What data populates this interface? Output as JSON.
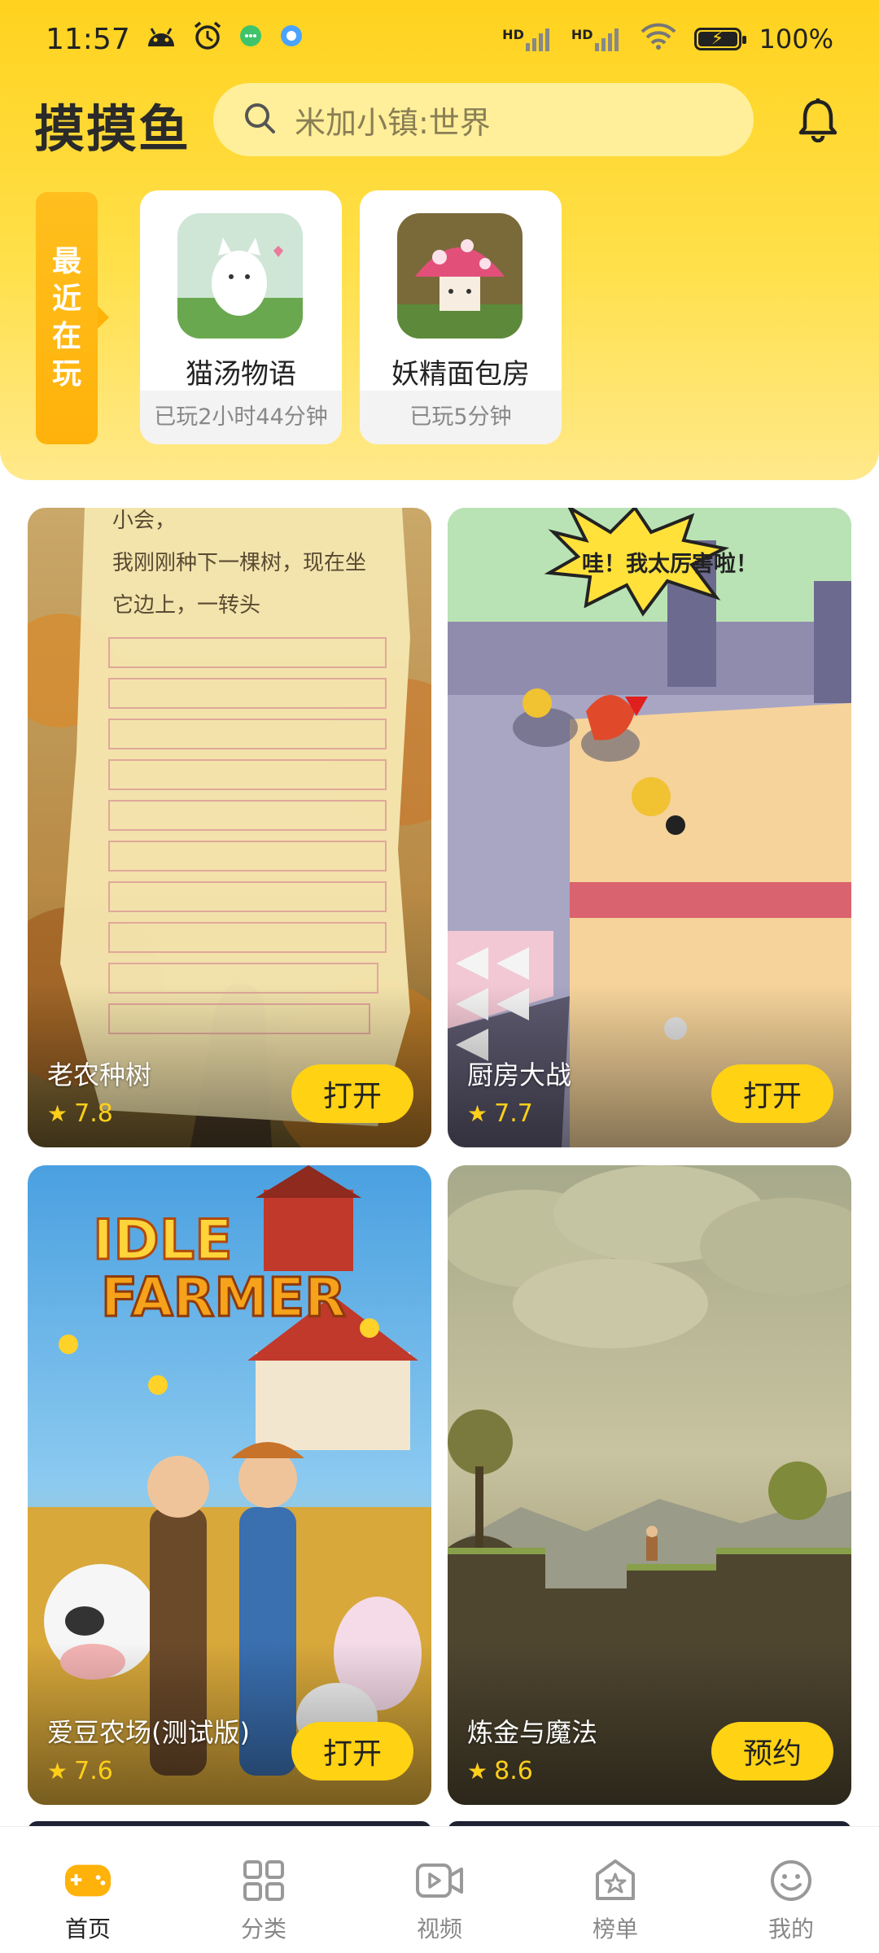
{
  "status_bar": {
    "time": "11:57",
    "net1": "HD",
    "net2": "HD",
    "battery": "100%"
  },
  "header": {
    "logo": "摸摸鱼",
    "search_placeholder": "米加小镇:世界"
  },
  "recent": {
    "label_chars": [
      "最",
      "近",
      "在",
      "玩"
    ],
    "items": [
      {
        "name": "猫汤物语",
        "played": "已玩2小时44分钟"
      },
      {
        "name": "妖精面包房",
        "played": "已玩5分钟"
      }
    ]
  },
  "games": [
    {
      "title": "老农种树",
      "rating": "7.8",
      "action": "打开",
      "art_text": [
        "小会，",
        "我刚刚种下一棵树，现在坐",
        "它边上，一转头"
      ]
    },
    {
      "title": "厨房大战",
      "rating": "7.7",
      "action": "打开",
      "art_text": [
        "哇！我太厉害啦！"
      ]
    },
    {
      "title": "爱豆农场(测试版)",
      "rating": "7.6",
      "action": "打开",
      "art_text": [
        "IDLE",
        "FARMER"
      ]
    },
    {
      "title": "炼金与魔法",
      "rating": "8.6",
      "action": "预约",
      "art_text": []
    }
  ],
  "nav": [
    {
      "label": "首页",
      "icon": "home-game-icon",
      "active": true
    },
    {
      "label": "分类",
      "icon": "category-grid-icon",
      "active": false
    },
    {
      "label": "视频",
      "icon": "video-icon",
      "active": false
    },
    {
      "label": "榜单",
      "icon": "ranking-icon",
      "active": false
    },
    {
      "label": "我的",
      "icon": "profile-icon",
      "active": false
    }
  ],
  "colors": {
    "brand_yellow": "#ffd21e",
    "button_yellow": "#ffd213",
    "rating_gold": "#ffcf1a",
    "nav_active": "#ffb20a"
  }
}
